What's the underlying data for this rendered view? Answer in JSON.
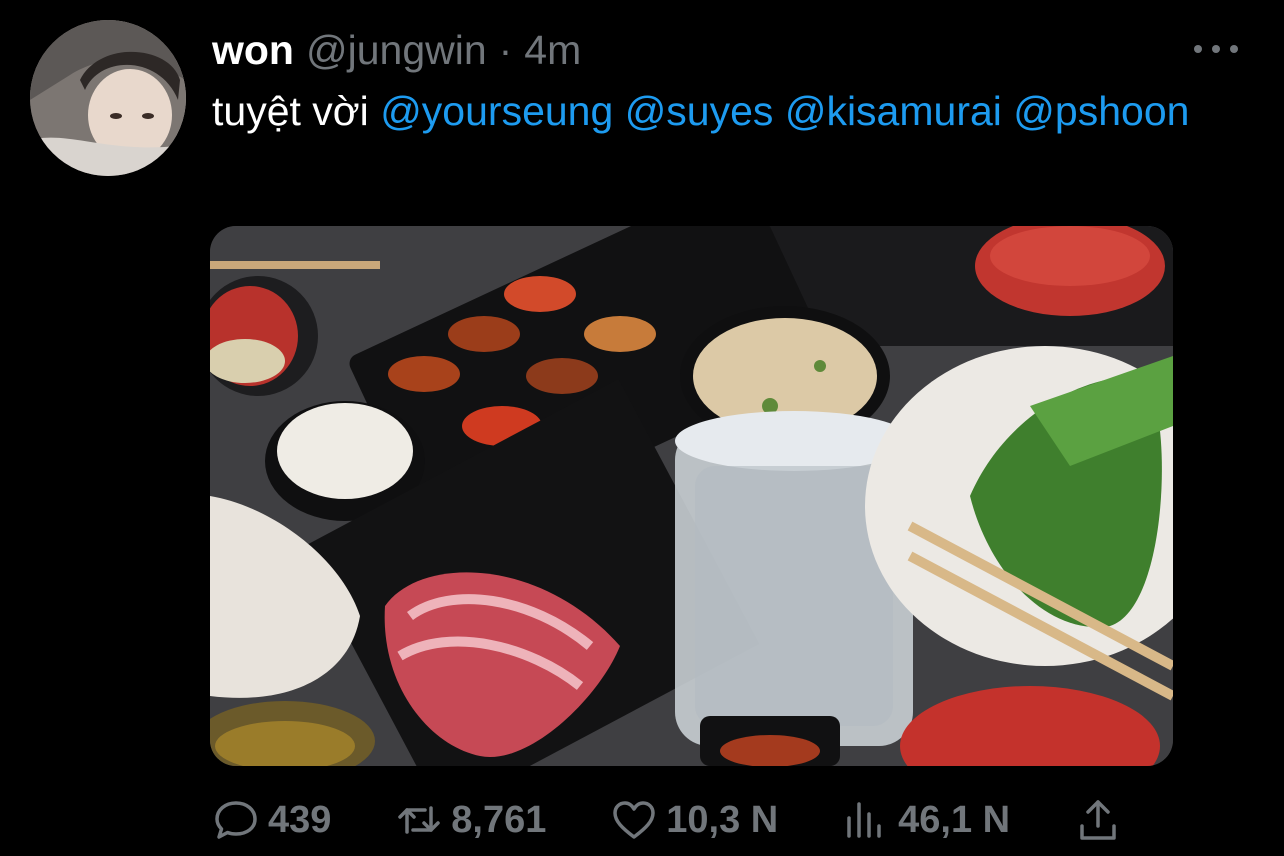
{
  "tweet": {
    "author_name": "won",
    "author_handle": "@jungwin",
    "separator": "·",
    "time": "4m",
    "text_prefix": "tuyệt vời",
    "mentions": [
      "@yourseung",
      "@suyes",
      "@kisamurai",
      "@pshoon"
    ]
  },
  "actions": {
    "replies": "439",
    "retweets": "8,761",
    "likes": "10,3 N",
    "views": "46,1 N"
  },
  "icons": {
    "reply": "comment-icon",
    "retweet": "retweet-icon",
    "like": "heart-icon",
    "views": "bar-chart-icon",
    "share": "share-upload-icon",
    "more": "more-horizontal-icon"
  },
  "colors": {
    "background": "#000000",
    "accent": "#1d9bf0",
    "text": "#ffffff",
    "muted": "#71767b"
  }
}
